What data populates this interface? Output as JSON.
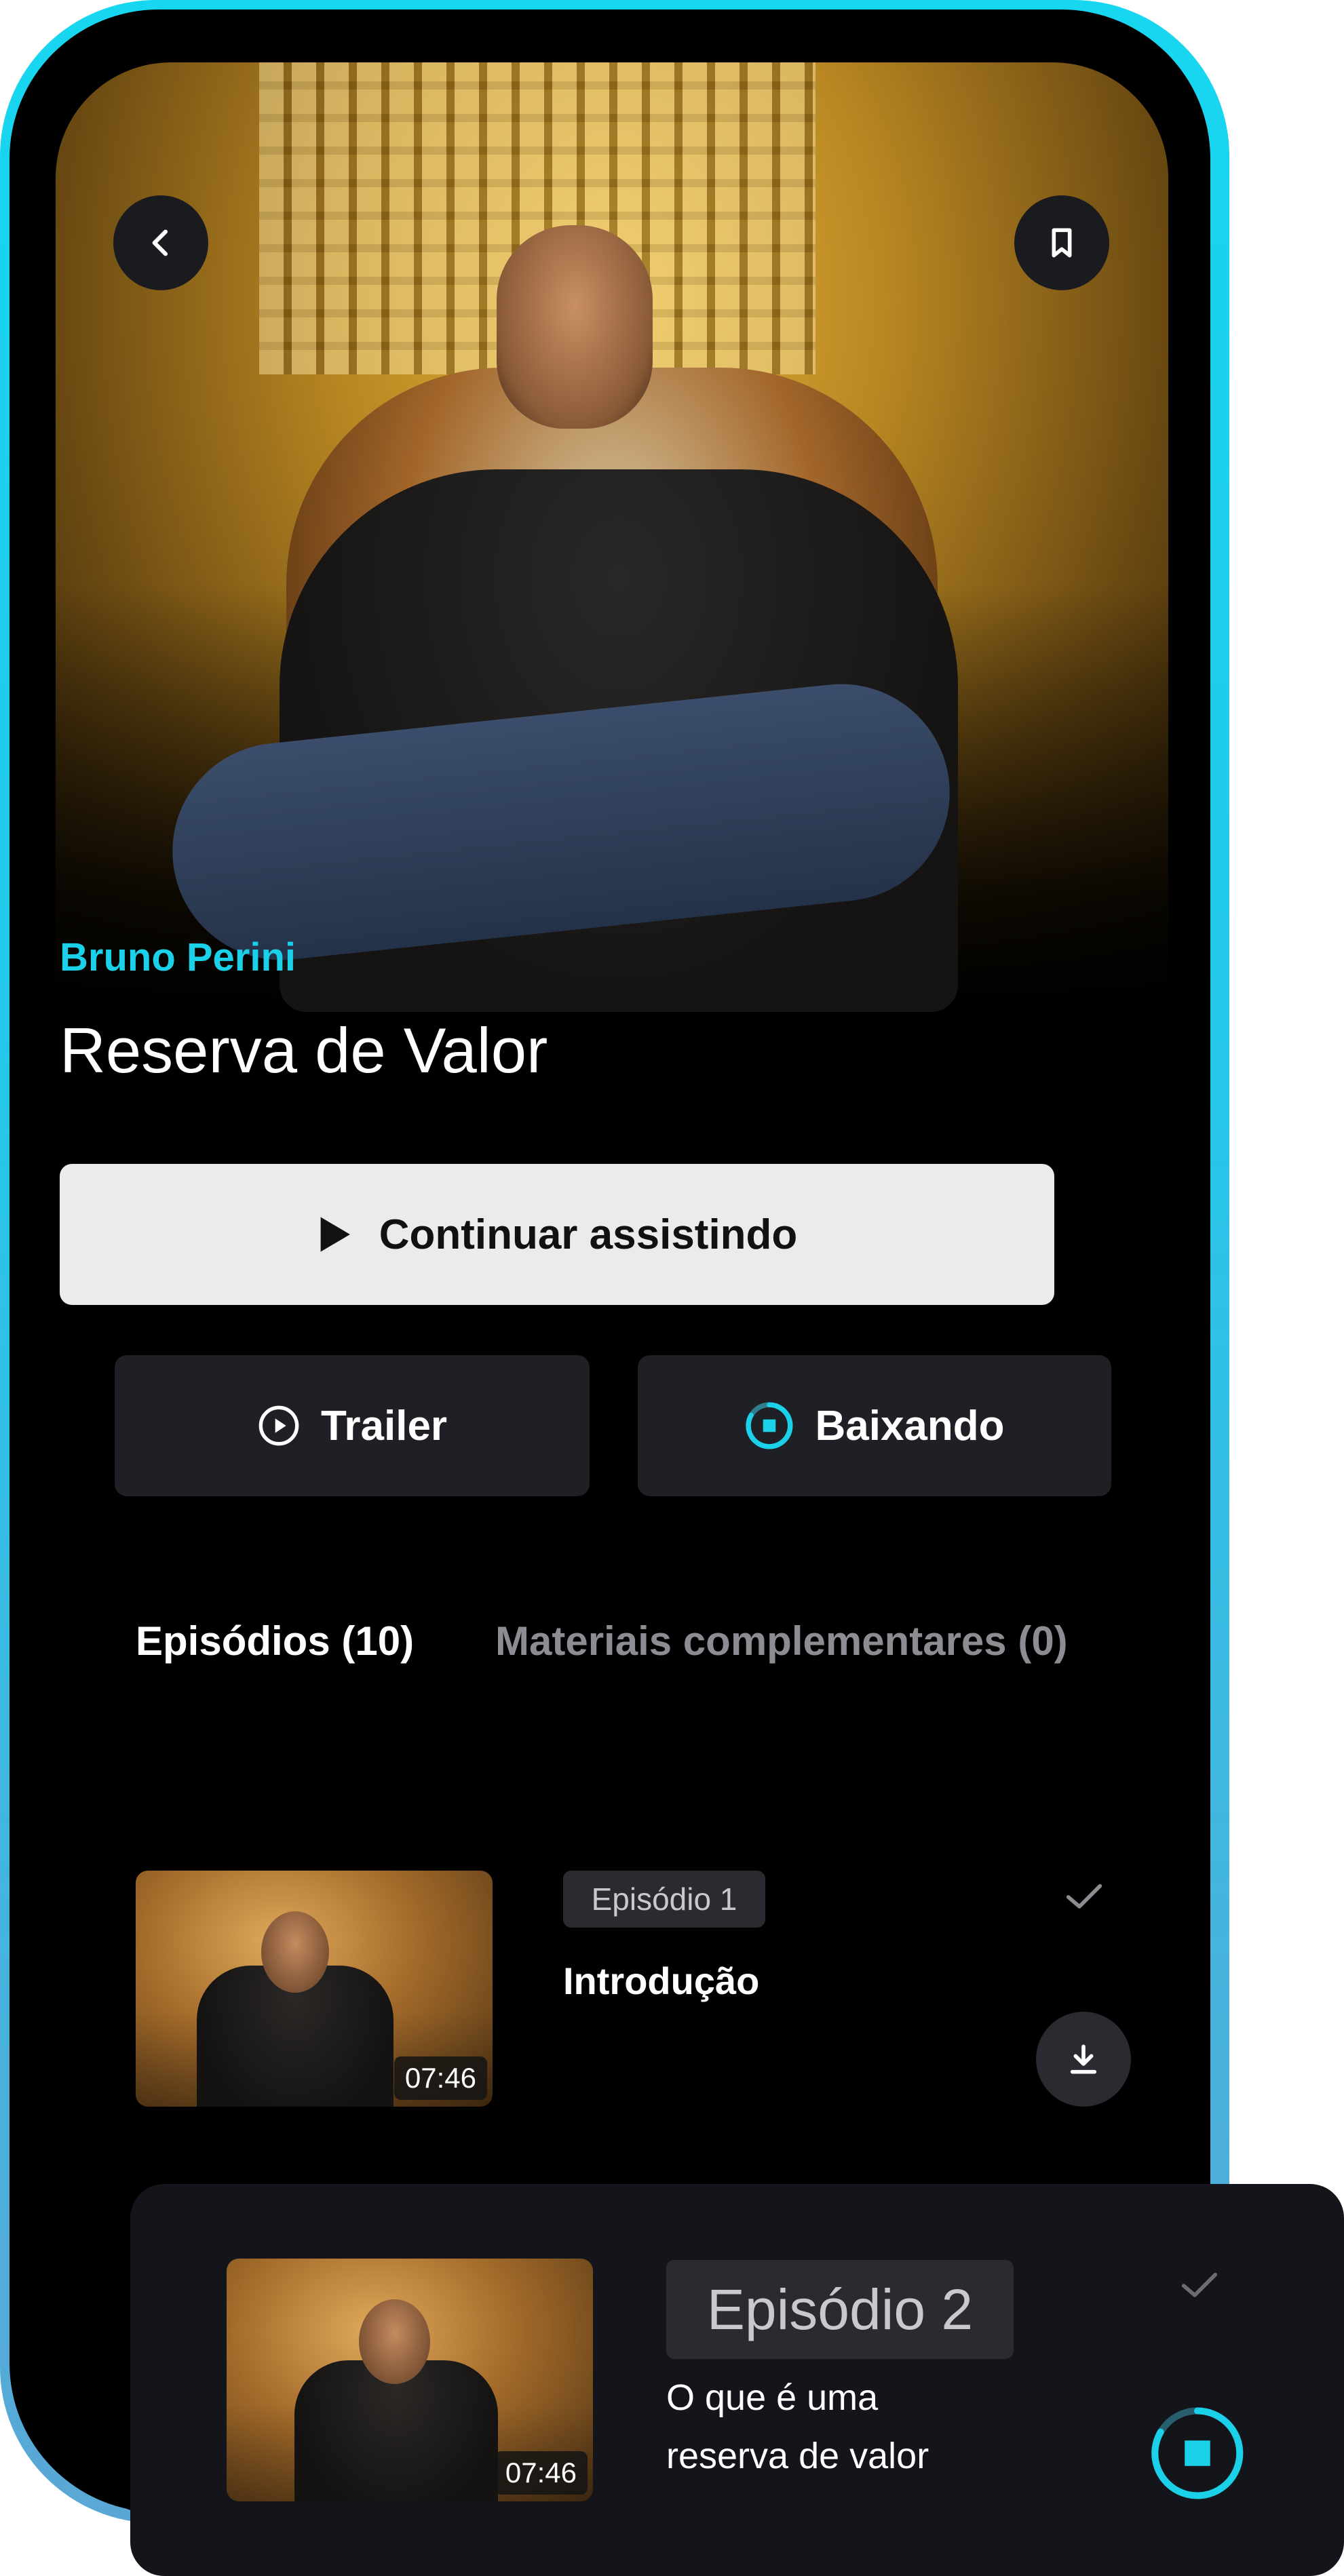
{
  "show": {
    "author": "Bruno Perini",
    "title": "Reserva de Valor"
  },
  "actions": {
    "continue_label": "Continuar assistindo",
    "trailer_label": "Trailer",
    "download_label": "Baixando"
  },
  "tabs": [
    {
      "label": "Episódios (10)",
      "active": true
    },
    {
      "label": "Materiais complementares (0)",
      "active": false
    }
  ],
  "episodes": [
    {
      "badge": "Episódio 1",
      "title": "Introdução",
      "duration": "07:46",
      "action": "download"
    },
    {
      "badge": "Episódio 2",
      "title_line1": "O que é uma",
      "title_line2": "reserva de valor",
      "duration": "07:46",
      "action": "downloading"
    }
  ],
  "icons": {
    "back": "chevron-left-icon",
    "bookmark": "bookmark-icon",
    "play": "play-icon",
    "play_circle": "play-circle-icon",
    "download": "download-icon",
    "stop": "stop-download-icon",
    "check": "check-icon"
  },
  "colors": {
    "accent": "#1bd1ea",
    "background": "#000000",
    "button_light": "#ebebeb",
    "button_dark": "#1f2026",
    "card": "#13151a"
  }
}
